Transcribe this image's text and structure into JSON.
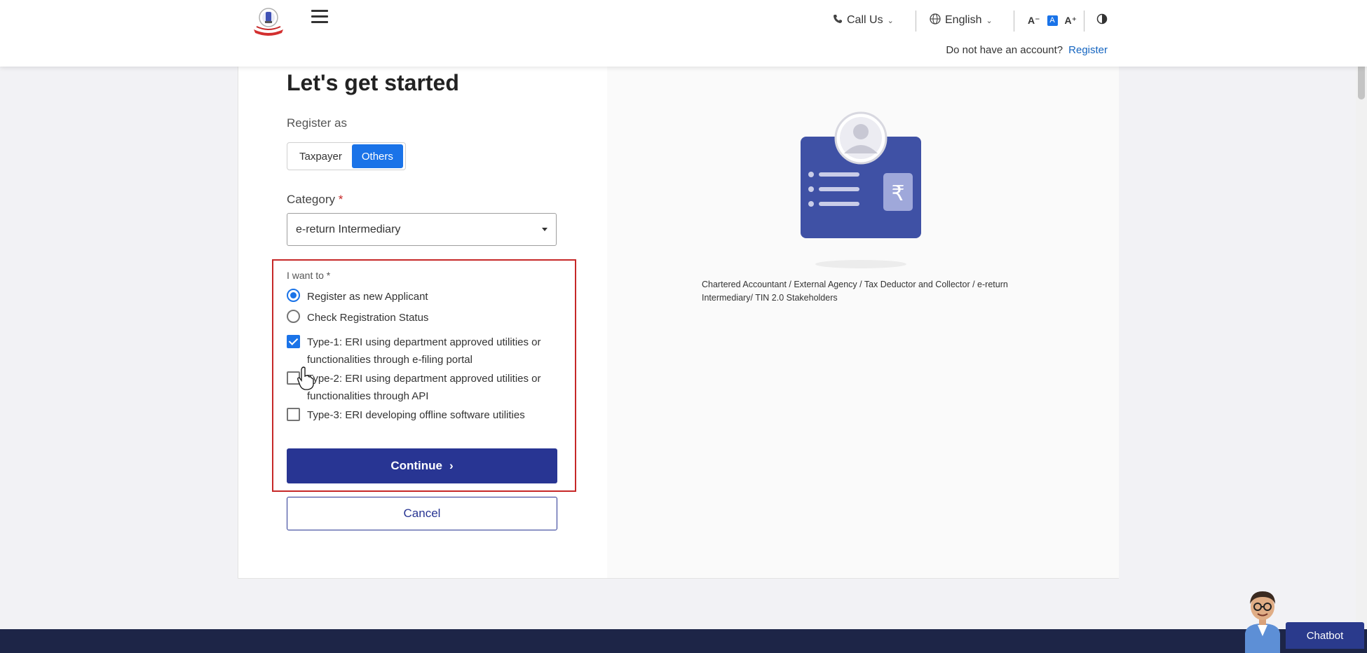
{
  "header": {
    "call_label": "Call Us",
    "language_label": "English",
    "font_decrease": "A⁻",
    "font_normal": "A",
    "font_increase": "A⁺",
    "no_account_text": "Do not have an account?",
    "register_link": "Register"
  },
  "form": {
    "title": "Let's get started",
    "register_as_label": "Register as",
    "toggle": {
      "taxpayer": "Taxpayer",
      "others": "Others",
      "selected": "Others"
    },
    "category_label": "Category",
    "category_required": "*",
    "category_value": "e-return Intermediary",
    "want_label": "I want to *",
    "radio_options": [
      {
        "label": "Register as new Applicant",
        "checked": true
      },
      {
        "label": "Check Registration Status",
        "checked": false
      }
    ],
    "type_options": [
      {
        "line1": "Type-1: ERI using department approved utilities or",
        "line2": "functionalities through e-filing portal",
        "checked": true
      },
      {
        "line1": "Type-2: ERI using department approved utilities or",
        "line2": "functionalities through API",
        "checked": false
      },
      {
        "line1": "Type-3: ERI developing offline software utilities",
        "line2": "",
        "checked": false
      }
    ],
    "continue_label": "Continue",
    "continue_chevron": "›",
    "cancel_label": "Cancel"
  },
  "illustration": {
    "caption": "Chartered Accountant / External Agency / Tax Deductor and Collector / e-return Intermediary/ TIN 2.0 Stakeholders",
    "symbol": "₹"
  },
  "chatbot": {
    "label": "Chatbot"
  },
  "colors": {
    "primary_blue": "#1a73e8",
    "navy": "#283593",
    "highlight_red": "#c62828",
    "footer": "#1d2547"
  }
}
